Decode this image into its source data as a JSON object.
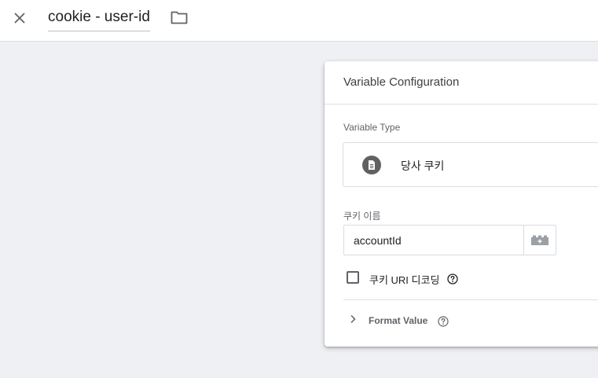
{
  "header": {
    "title": "cookie - user-id",
    "close_icon": "close-icon",
    "folder_icon": "folder-icon"
  },
  "panel": {
    "title": "Variable Configuration",
    "variable_type": {
      "label": "Variable Type",
      "name": "당사 쿠키",
      "icon": "document-icon"
    },
    "cookie_name": {
      "label": "쿠키 이름",
      "value": "accountId",
      "picker_icon": "variable-picker-icon"
    },
    "uri_decode": {
      "label": "쿠키 URI 디코딩",
      "checked": false,
      "help_icon": "help-icon"
    },
    "format_value": {
      "label": "Format Value",
      "expanded": false,
      "help_icon": "help-icon"
    }
  },
  "colors": {
    "background": "#eef0f3",
    "panel": "#ffffff",
    "type_icon": "#616161",
    "border": "#dadce0"
  }
}
